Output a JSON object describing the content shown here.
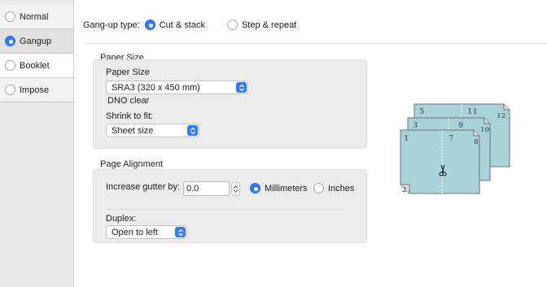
{
  "modes": [
    {
      "label": "Normal",
      "selected": false
    },
    {
      "label": "Gangup",
      "selected": true
    },
    {
      "label": "Booklet",
      "selected": false
    },
    {
      "label": "Impose",
      "selected": false
    }
  ],
  "gangup": {
    "type_label": "Gang-up type:",
    "options": [
      {
        "label": "Cut & stack",
        "selected": true
      },
      {
        "label": "Step & repeat",
        "selected": false
      }
    ]
  },
  "paper_size": {
    "section_title": "Paper Size",
    "field_label": "Paper Size",
    "value": "SRA3 (320 x 450 mm)",
    "status_text": "DNO clear",
    "shrink_label": "Shrink to fit:",
    "shrink_value": "Sheet size"
  },
  "page_alignment": {
    "section_title": "Page Alignment",
    "gutter_label": "Increase gutter by:",
    "gutter_value": "0.0",
    "units": [
      {
        "label": "Millimeters",
        "selected": true
      },
      {
        "label": "Inches",
        "selected": false
      }
    ],
    "duplex_label": "Duplex:",
    "duplex_value": "Open to left"
  },
  "diagram": {
    "sheets": [
      {
        "left": "5",
        "right": "11",
        "corner": "12"
      },
      {
        "left": "3",
        "right": "9",
        "corner": "10"
      },
      {
        "left": "1",
        "right": "7",
        "corner": "8",
        "bottom_corner": "2"
      }
    ],
    "colors": {
      "sheet": "#a9d3d8",
      "edge": "#6f6f6f",
      "number": "#5a6f87"
    }
  }
}
